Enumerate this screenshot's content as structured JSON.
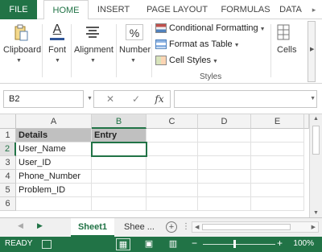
{
  "ribbon_tabs": {
    "file": "FILE",
    "home": "HOME",
    "insert": "INSERT",
    "page_layout": "PAGE LAYOUT",
    "formulas": "FORMULAS",
    "data": "DATA",
    "more": "▸"
  },
  "ribbon": {
    "clipboard": "Clipboard",
    "font": "Font",
    "alignment": "Alignment",
    "number": "Number",
    "number_symbol": "%",
    "conditional_formatting": "Conditional Formatting",
    "format_as_table": "Format as Table",
    "cell_styles": "Cell Styles",
    "styles_group": "Styles",
    "cells": "Cells",
    "font_letter": "A"
  },
  "formula_bar": {
    "name_box": "B2",
    "cancel": "✕",
    "enter": "✓",
    "fx": "fx",
    "content": ""
  },
  "grid": {
    "columns": [
      "A",
      "B",
      "C",
      "D",
      "E"
    ],
    "rows": [
      "1",
      "2",
      "3",
      "4",
      "5",
      "6"
    ],
    "cells": {
      "A1": "Details",
      "B1": "Entry",
      "A2": "User_Name",
      "A3": "User_ID",
      "A4": "Phone_Number",
      "A5": "Problem_ID"
    }
  },
  "sheets": {
    "active": "Sheet1",
    "other": "Shee ...",
    "add": "+"
  },
  "status": {
    "ready": "READY",
    "zoom_out": "−",
    "zoom_in": "+",
    "zoom_level": "100%"
  },
  "colors": {
    "accent": "#217346",
    "header_fill": "#c0c0c0"
  }
}
